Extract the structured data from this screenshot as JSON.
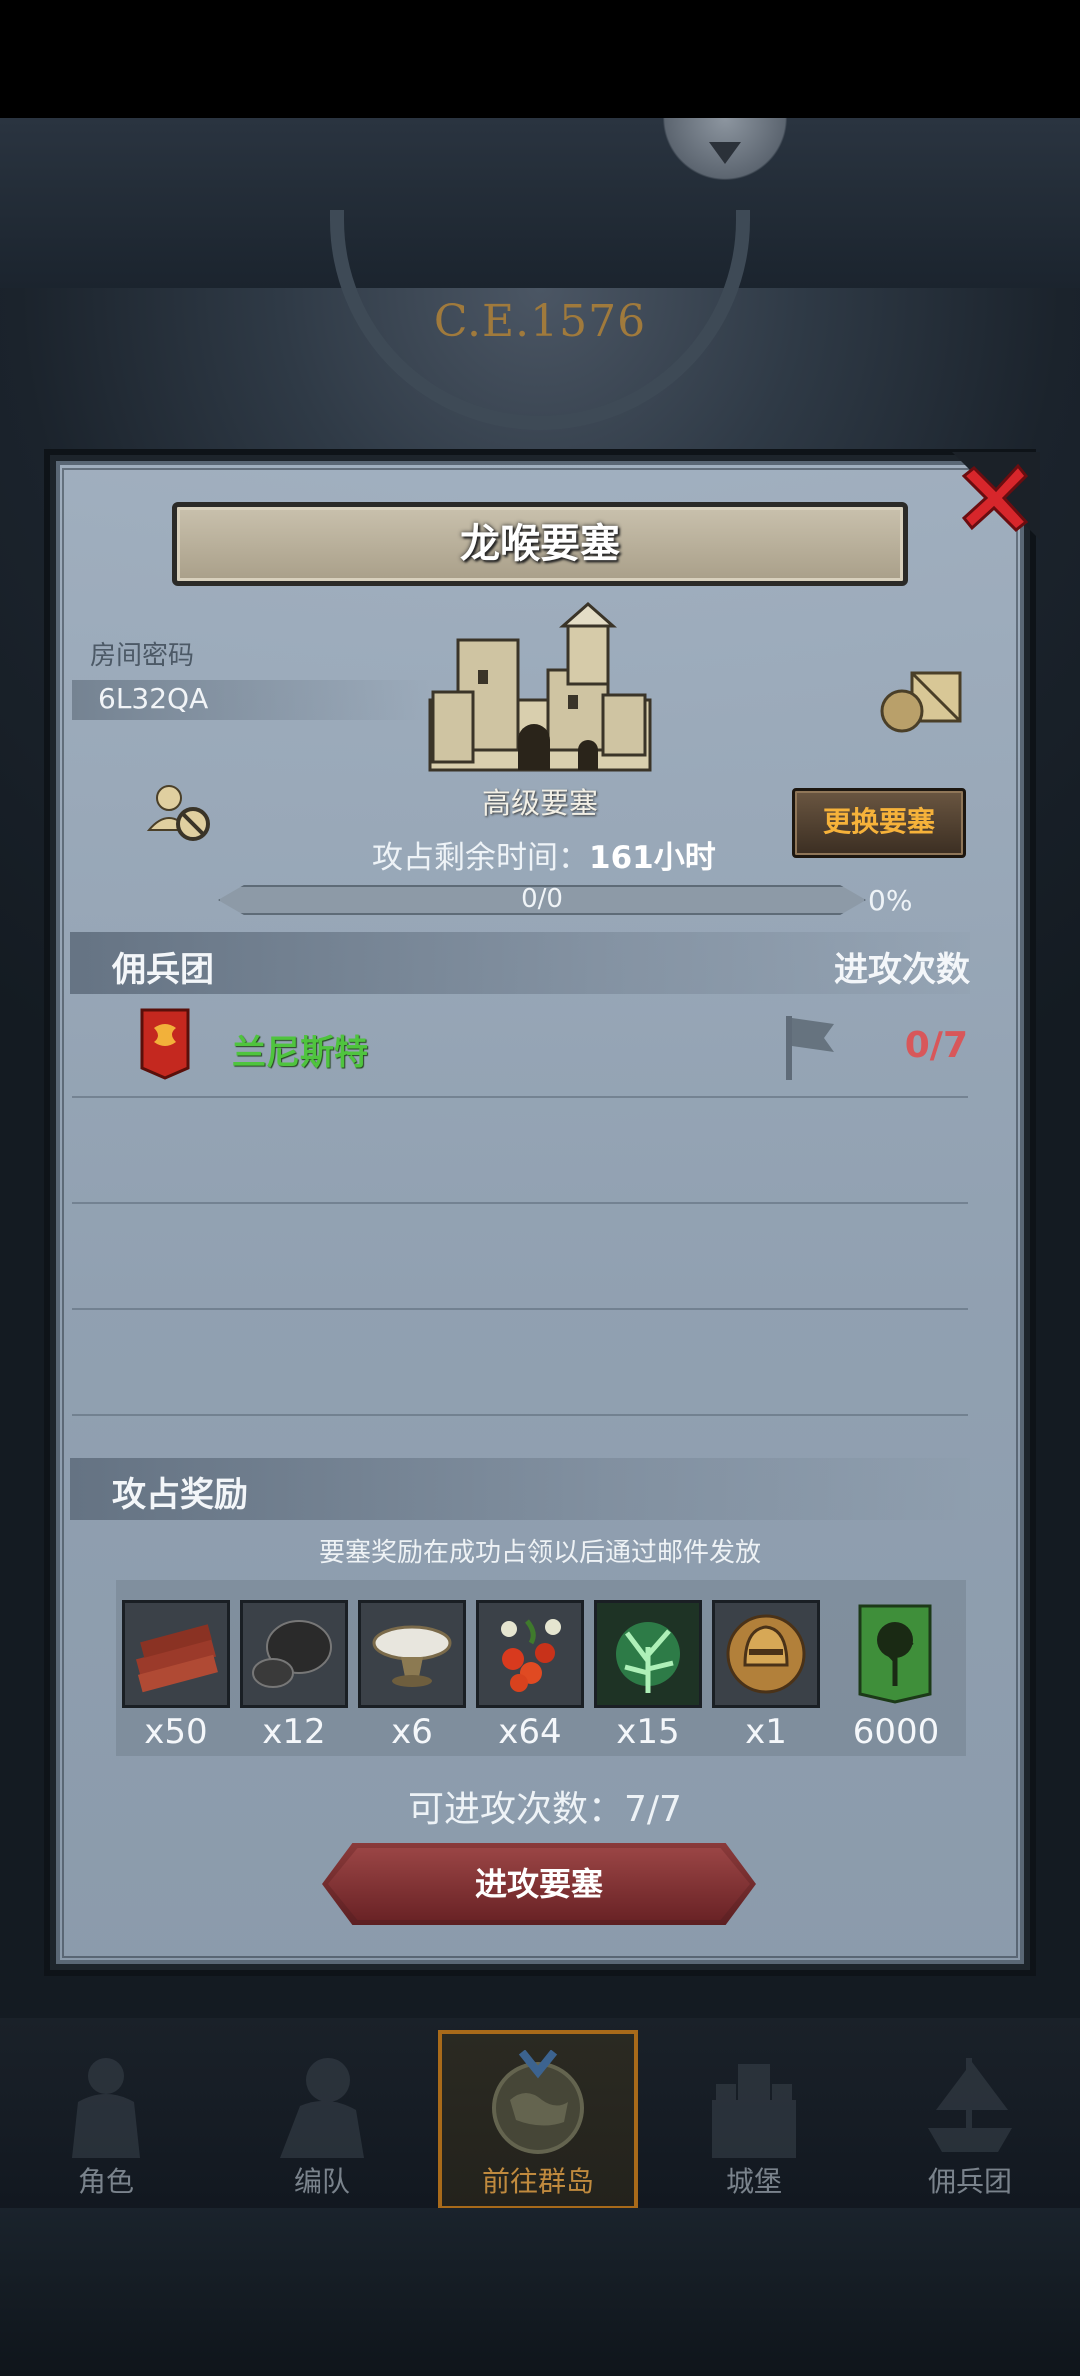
{
  "scene": {
    "era": "C.E.1576"
  },
  "dialog": {
    "title": "龙喉要塞",
    "room_code_label": "房间密码",
    "room_code": "6L32QA",
    "fortress_level": "高级要塞",
    "change_button": "更换要塞",
    "time_remaining_label": "攻占剩余时间：",
    "time_remaining_hours": "161小时",
    "progress_text": "0/0",
    "progress_percent": "0%",
    "progress_fraction": 0,
    "mercenary_header": "佣兵团",
    "attack_count_header": "进攻次数",
    "guild": {
      "name": "兰尼斯特",
      "attacks": "0/7"
    },
    "reward_header": "攻占奖励",
    "reward_note": "要塞奖励在成功占领以后通过邮件发放",
    "rewards": [
      {
        "icon": "wood-logs-icon",
        "count": "x50"
      },
      {
        "icon": "ore-rock-icon",
        "count": "x12"
      },
      {
        "icon": "salt-bowl-icon",
        "count": "x6"
      },
      {
        "icon": "berries-icon",
        "count": "x64"
      },
      {
        "icon": "green-tree-spirit-icon",
        "count": "x15"
      },
      {
        "icon": "golden-helmet-icon",
        "count": "x1"
      },
      {
        "icon": "green-tree-banner-icon",
        "count": "6000"
      }
    ],
    "attempts_available": "可进攻次数：7/7",
    "attack_button": "进攻要塞"
  },
  "nav": {
    "items": [
      {
        "label": "角色",
        "icon": "knight-icon"
      },
      {
        "label": "编队",
        "icon": "formation-icon"
      },
      {
        "label": "前往群岛",
        "icon": "islands-map-icon",
        "active": true
      },
      {
        "label": "城堡",
        "icon": "castle-icon"
      },
      {
        "label": "佣兵团",
        "icon": "ship-icon"
      }
    ]
  },
  "colors": {
    "guild_green": "#4fc43e",
    "attack_count_red": "#d8575a",
    "change_button_text": "#f6b23a",
    "active_nav_border": "#a86a1a"
  }
}
